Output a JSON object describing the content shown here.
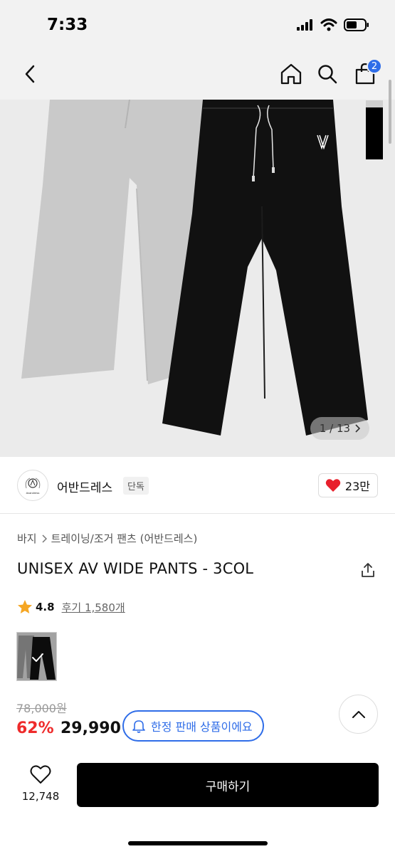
{
  "status": {
    "time": "7:33"
  },
  "nav": {
    "cart_count": "2"
  },
  "gallery": {
    "page_current": "1",
    "page_total": "13",
    "page_label": "1 / 13"
  },
  "seller": {
    "logo_text": "Avandress",
    "name": "어반드레스",
    "badge": "단독",
    "likes": "23만"
  },
  "breadcrumb": {
    "category": "바지",
    "subcategory": "트레이닝/조거 팬츠 (어반드레스)"
  },
  "product": {
    "title": "UNISEX AV WIDE PANTS - 3COL",
    "rating": "4.8",
    "reviews": "후기 1,580개",
    "original_price": "78,000원",
    "discount": "62%",
    "sale_price": "29,990",
    "limited_label": "한정 판매 상품이에요"
  },
  "bottom": {
    "wish_count": "12,748",
    "buy_label": "구매하기"
  },
  "colors": {
    "accent": "#2f6de8",
    "discount": "#ee2b2b",
    "like": "#e8202c"
  }
}
